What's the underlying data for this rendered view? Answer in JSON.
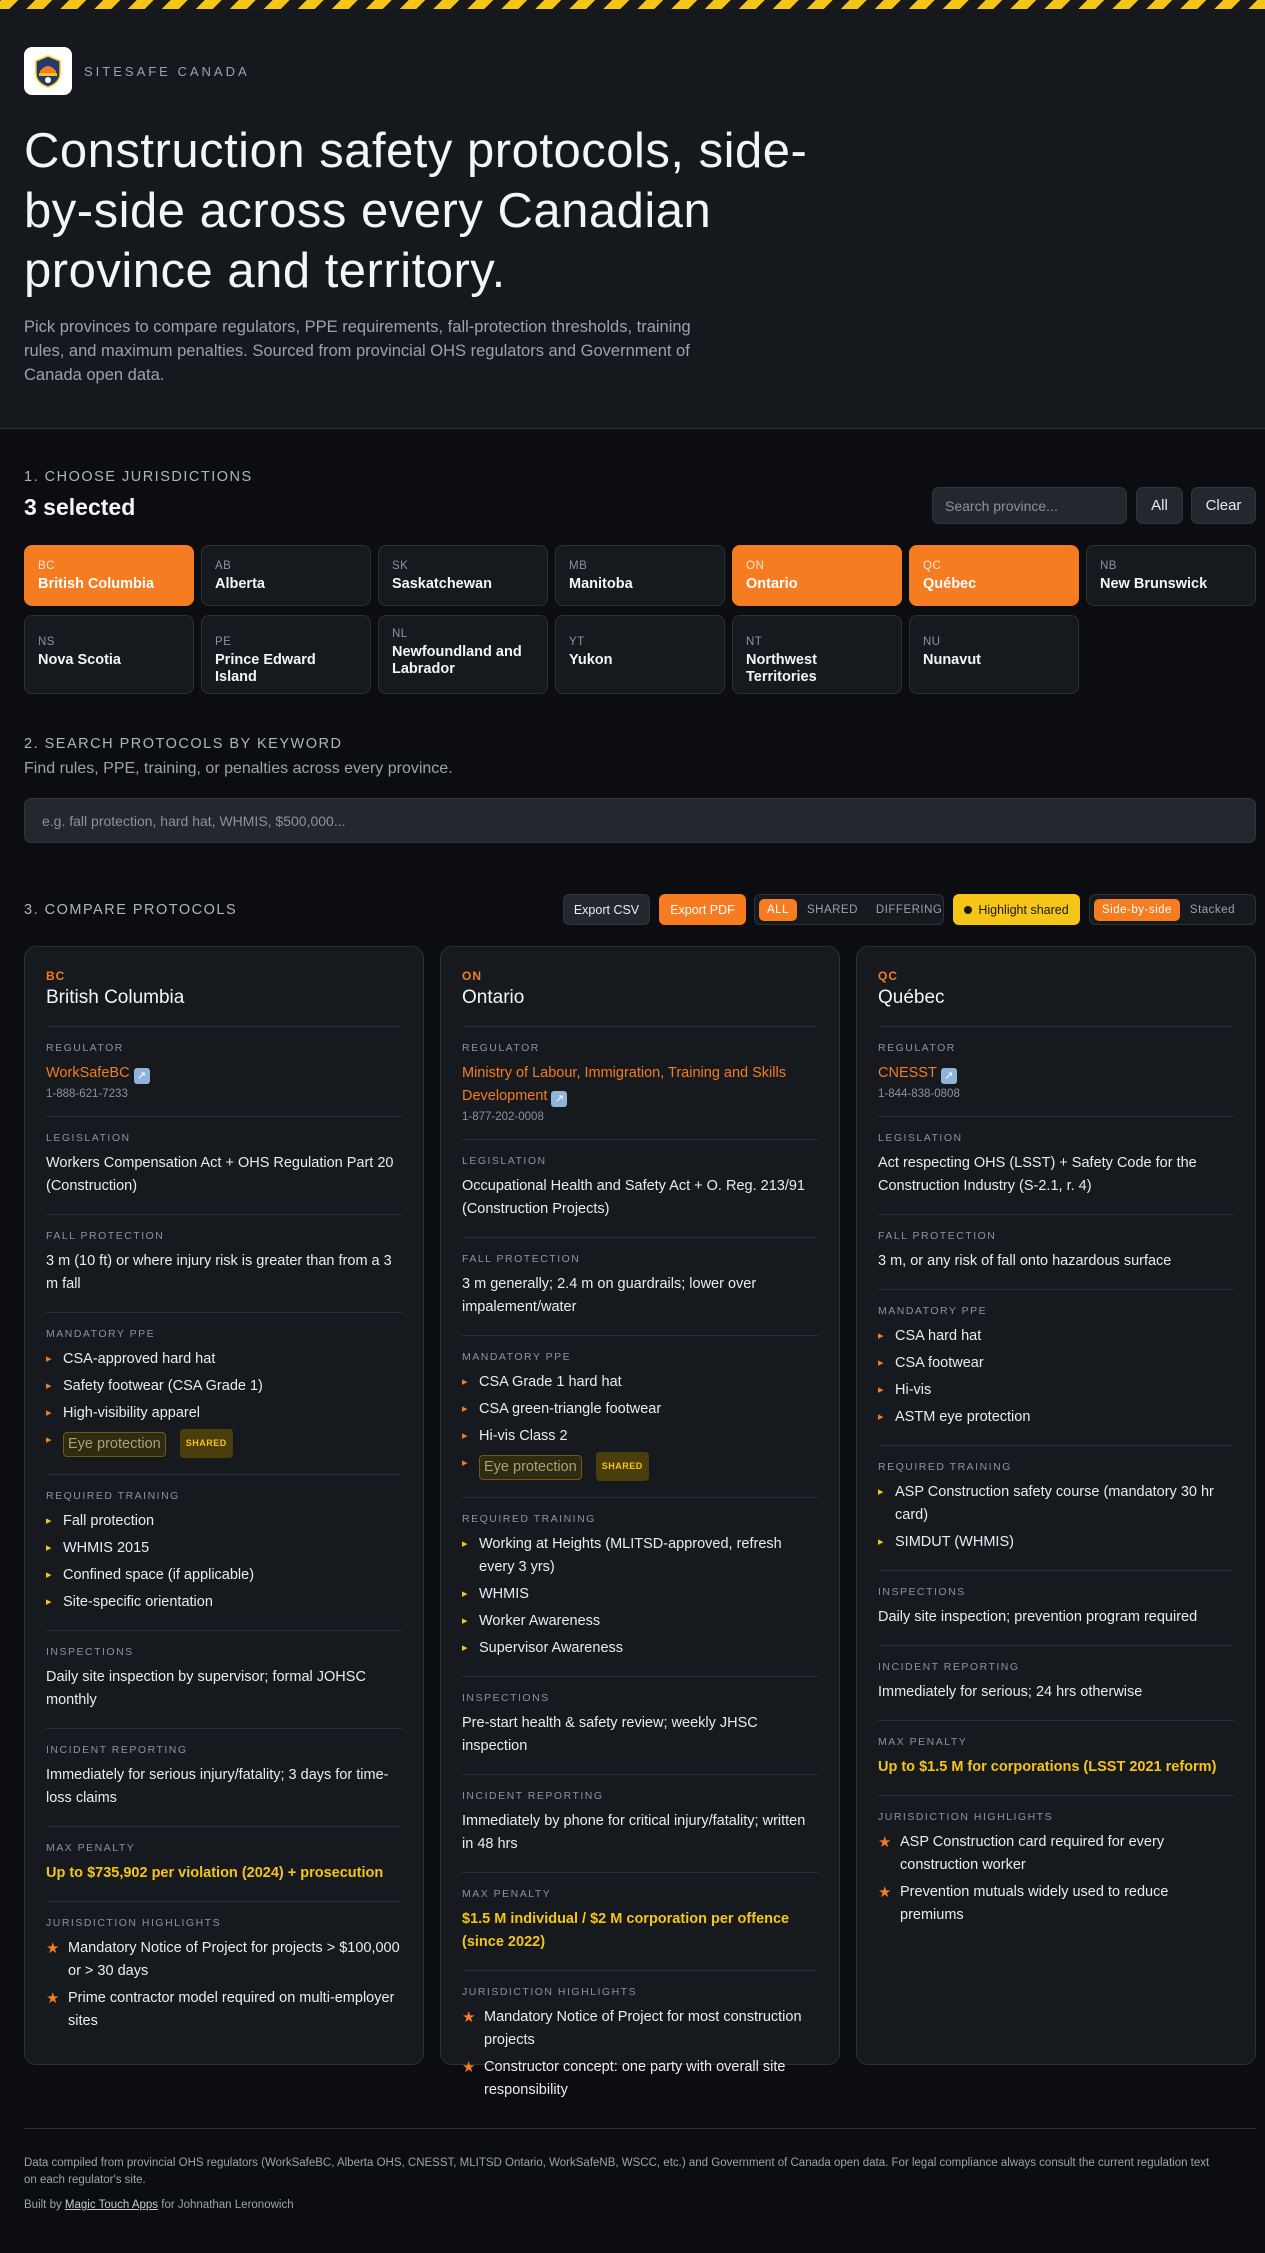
{
  "brand": {
    "name": "SITESAFE CANADA",
    "logo_icon": "construction-badge-icon"
  },
  "hero": {
    "title": "Construction safety protocols, side-by-side across every Canadian province and territory.",
    "subtitle": "Pick provinces to compare regulators, PPE requirements, fall-protection thresholds, training rules, and maximum penalties. Sourced from provincial OHS regulators and Government of Canada open data."
  },
  "jurisdictions": {
    "label": "1. CHOOSE JURISDICTIONS",
    "count_text": "3 selected",
    "search_placeholder": "Search province...",
    "all_label": "All",
    "clear_label": "Clear",
    "chips": [
      {
        "code": "BC",
        "name": "British Columbia",
        "selected": true
      },
      {
        "code": "AB",
        "name": "Alberta",
        "selected": false
      },
      {
        "code": "SK",
        "name": "Saskatchewan",
        "selected": false
      },
      {
        "code": "MB",
        "name": "Manitoba",
        "selected": false
      },
      {
        "code": "ON",
        "name": "Ontario",
        "selected": true
      },
      {
        "code": "QC",
        "name": "Québec",
        "selected": true
      },
      {
        "code": "NB",
        "name": "New Brunswick",
        "selected": false
      },
      {
        "code": "NS",
        "name": "Nova Scotia",
        "selected": false
      },
      {
        "code": "PE",
        "name": "Prince Edward Island",
        "selected": false
      },
      {
        "code": "NL",
        "name": "Newfoundland and Labrador",
        "selected": false
      },
      {
        "code": "YT",
        "name": "Yukon",
        "selected": false
      },
      {
        "code": "NT",
        "name": "Northwest Territories",
        "selected": false
      },
      {
        "code": "NU",
        "name": "Nunavut",
        "selected": false
      }
    ]
  },
  "keyword": {
    "label": "2. SEARCH PROTOCOLS BY KEYWORD",
    "subtitle": "Find rules, PPE, training, or penalties across every province.",
    "placeholder": "e.g. fall protection, hard hat, WHMIS, $500,000..."
  },
  "compare": {
    "label": "3. COMPARE PROTOCOLS",
    "export_csv": "Export CSV",
    "export_pdf": "Export PDF",
    "filter": {
      "all": "ALL",
      "shared": "SHARED",
      "differing": "DIFFERING",
      "active": "ALL"
    },
    "highlight_label": "Highlight shared",
    "layout": {
      "side": "Side-by-side",
      "stacked": "Stacked",
      "active": "Side-by-side"
    },
    "labels": {
      "regulator": "REGULATOR",
      "legislation": "LEGISLATION",
      "fall": "FALL PROTECTION",
      "ppe": "MANDATORY PPE",
      "training": "REQUIRED TRAINING",
      "inspections": "INSPECTIONS",
      "incident": "INCIDENT REPORTING",
      "penalty": "MAX PENALTY",
      "highlights": "JURISDICTION HIGHLIGHTS"
    },
    "shared_tag": "SHARED",
    "columns": [
      {
        "code": "BC",
        "name": "British Columbia",
        "regulator": "WorkSafeBC",
        "phone": "1-888-621-7233",
        "legislation": "Workers Compensation Act + OHS Regulation Part 20 (Construction)",
        "fall": "3 m (10 ft) or where injury risk is greater than from a 3 m fall",
        "ppe": [
          "CSA-approved hard hat",
          "Safety footwear (CSA Grade 1)",
          "High-visibility apparel"
        ],
        "ppe_shared": "Eye protection",
        "training": [
          "Fall protection",
          "WHMIS 2015",
          "Confined space (if applicable)",
          "Site-specific orientation"
        ],
        "inspections": "Daily site inspection by supervisor; formal JOHSC monthly",
        "incident": "Immediately for serious injury/fatality; 3 days for time-loss claims",
        "penalty": "Up to $735,902 per violation (2024) + prosecution",
        "highlights": [
          "Mandatory Notice of Project for projects > $100,000 or > 30 days",
          "Prime contractor model required on multi-employer sites"
        ]
      },
      {
        "code": "ON",
        "name": "Ontario",
        "regulator": "Ministry of Labour, Immigration, Training and Skills Development",
        "phone": "1-877-202-0008",
        "legislation": "Occupational Health and Safety Act + O. Reg. 213/91 (Construction Projects)",
        "fall": "3 m generally; 2.4 m on guardrails; lower over impalement/water",
        "ppe": [
          "CSA Grade 1 hard hat",
          "CSA green-triangle footwear",
          "Hi-vis Class 2"
        ],
        "ppe_shared": "Eye protection",
        "training": [
          "Working at Heights (MLITSD-approved, refresh every 3 yrs)",
          "WHMIS",
          "Worker Awareness",
          "Supervisor Awareness"
        ],
        "inspections": "Pre-start health & safety review; weekly JHSC inspection",
        "incident": "Immediately by phone for critical injury/fatality; written in 48 hrs",
        "penalty": "$1.5 M individual / $2 M corporation per offence (since 2022)",
        "highlights": [
          "Mandatory Notice of Project for most construction projects",
          "Constructor concept: one party with overall site responsibility"
        ]
      },
      {
        "code": "QC",
        "name": "Québec",
        "regulator": "CNESST",
        "phone": "1-844-838-0808",
        "legislation": "Act respecting OHS (LSST) + Safety Code for the Construction Industry (S-2.1, r. 4)",
        "fall": "3 m, or any risk of fall onto hazardous surface",
        "ppe": [
          "CSA hard hat",
          "CSA footwear",
          "Hi-vis",
          "ASTM eye protection"
        ],
        "training": [
          "ASP Construction safety course (mandatory 30 hr card)",
          "SIMDUT (WHMIS)"
        ],
        "inspections": "Daily site inspection; prevention program required",
        "incident": "Immediately for serious; 24 hrs otherwise",
        "penalty": "Up to $1.5 M for corporations (LSST 2021 reform)",
        "highlights": [
          "ASP Construction card required for every construction worker",
          "Prevention mutuals widely used to reduce premiums"
        ]
      }
    ]
  },
  "footer": {
    "note": "Data compiled from provincial OHS regulators (WorkSafeBC, Alberta OHS, CNESST, MLITSD Ontario, WorkSafeNB, WSCC, etc.) and Government of Canada open data. For legal compliance always consult the current regulation text on each regulator's site.",
    "built_prefix": "Built by",
    "built_link": "Magic Touch Apps",
    "built_suffix": "for Johnathan Leronowich"
  },
  "colors": {
    "accent": "#f57c21",
    "highlight": "#f5c518",
    "background": "#0b0d10",
    "panel": "#16191e"
  }
}
